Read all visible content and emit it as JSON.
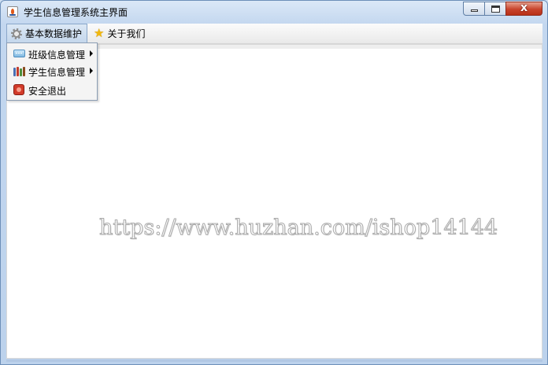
{
  "window": {
    "title": "学生信息管理系统主界面",
    "icon": "java-cup-icon",
    "controls": {
      "minimize": "minimize-icon",
      "maximize": "maximize-icon",
      "close_glyph": "x",
      "close": "close-icon"
    }
  },
  "menubar": {
    "menus": [
      {
        "label": "基本数据维护",
        "icon": "gear-icon",
        "open": true
      },
      {
        "label": "关于我们",
        "icon": "star-icon",
        "open": false
      }
    ]
  },
  "dropdown": {
    "items": [
      {
        "label": "班级信息管理",
        "icon": "class-icon",
        "submenu": true
      },
      {
        "label": "学生信息管理",
        "icon": "books-icon",
        "submenu": true
      },
      {
        "label": "安全退出",
        "icon": "exit-icon",
        "submenu": false
      }
    ]
  },
  "content": {
    "watermark": "https://www.huzhan.com/ishop14144"
  },
  "colors": {
    "title_bar": "#c3d7ef",
    "close_button": "#c8442c",
    "menu_highlight": "#c5d7ec"
  }
}
